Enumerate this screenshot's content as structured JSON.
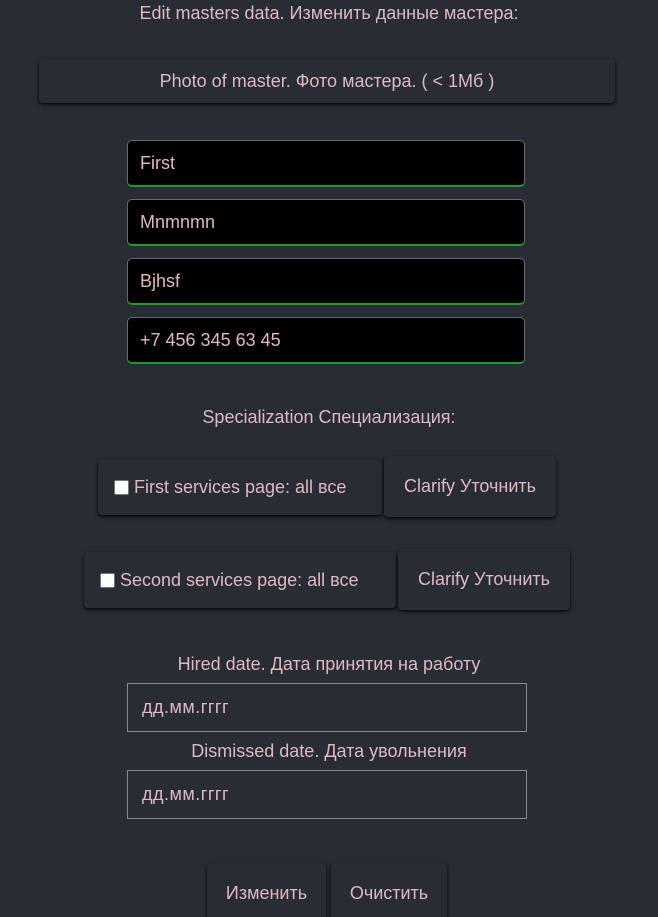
{
  "form": {
    "title": "Edit masters data. Изменить данные мастера:",
    "photo_button": "Photo of master. Фото мастера. ( < 1Мб )",
    "first_name": "First",
    "last_name": "Mnmnmn",
    "patronymic": "Bjhsf",
    "phone": "+7 456 345 63 45"
  },
  "specialization": {
    "label": "Specialization Специализация:",
    "services": [
      {
        "label": "First services page: all все",
        "checked": false,
        "clarify": "Clarify Уточнить"
      },
      {
        "label": "Second services page: all все",
        "checked": false,
        "clarify": "Clarify Уточнить"
      }
    ]
  },
  "dates": {
    "hired_label": "Hired date. Дата принятия на работу",
    "hired_placeholder": "дд.мм.гггг",
    "dismissed_label": "Dismissed date. Дата увольнения",
    "dismissed_placeholder": "дд.мм.гггг"
  },
  "actions": {
    "submit": "Изменить",
    "clear": "Очистить"
  },
  "colors": {
    "background": "#282c34",
    "text": "#e0b8c0",
    "input_background": "#000000",
    "input_underline": "#1e9a2a"
  }
}
